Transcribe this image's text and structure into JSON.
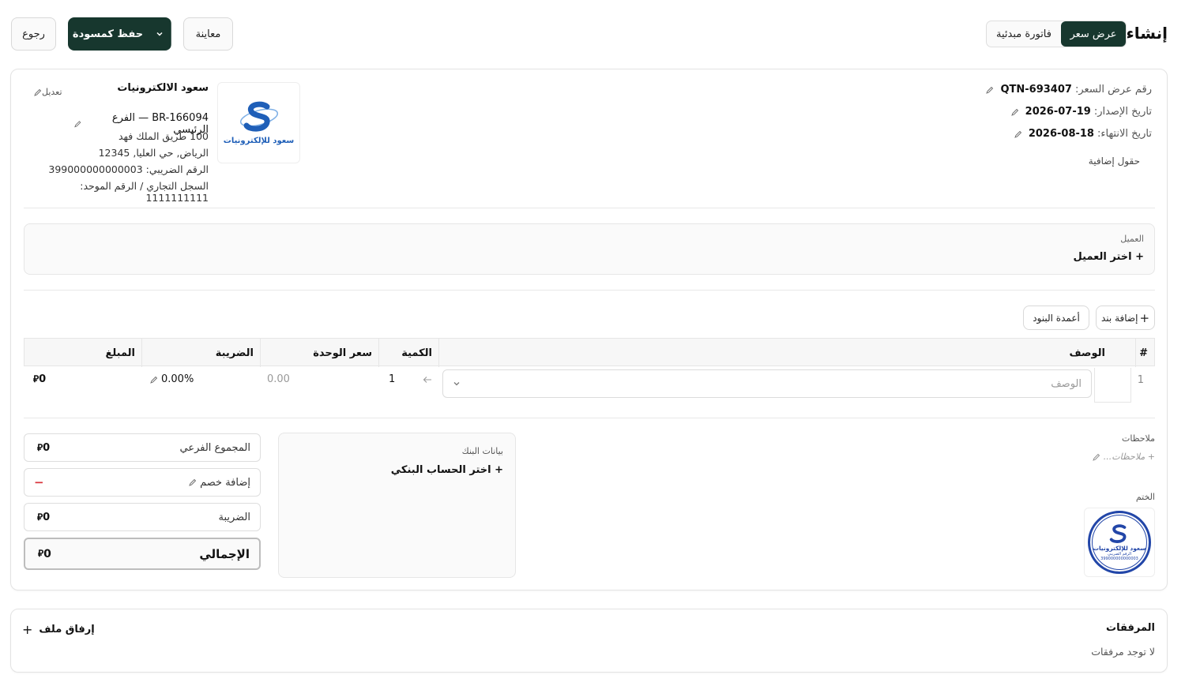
{
  "header": {
    "title": "إنشاء",
    "type_tabs": [
      {
        "label": "عرض سعر",
        "active": true
      },
      {
        "label": "فاتورة مبدئية",
        "active": false
      }
    ],
    "preview_label": "معاينة",
    "save_draft_label": "حفظ كمسودة",
    "back_label": "رجوع"
  },
  "doc_info": {
    "number_label": "رقم عرض السعر:",
    "number_value": "QTN-693407",
    "issue_label": "تاريخ الإصدار:",
    "issue_value": "2026-07-19",
    "expiry_label": "تاريخ الانتهاء:",
    "expiry_value": "2026-08-18",
    "extra_fields": "حقول إضافية"
  },
  "company": {
    "name": "سعود الالكترونيات",
    "edit_label": "تعديل",
    "branch": "BR-166094 — الفرع الرئيسي",
    "address1": "100 طريق الملك فهد",
    "address2": "الرياض, حي العليا, 12345",
    "vat": "الرقم الضريبي: 399000000000003",
    "cr": "السجل التجاري / الرقم الموحد: 1111111111",
    "logo_text": "سعود للإلكترونيات"
  },
  "customer": {
    "label": "العميل",
    "select": "+ اختر العميل"
  },
  "items": {
    "add_item": "إضافة بند",
    "columns_btn": "أعمدة البنود",
    "headers": {
      "num": "#",
      "desc": "الوصف",
      "qty": "الكمية",
      "unit": "سعر الوحدة",
      "tax": "الضريبة",
      "amount": "المبلغ"
    },
    "rows": [
      {
        "num": "1",
        "desc_placeholder": "الوصف",
        "qty": "1",
        "unit": "0.00",
        "tax": "0.00%",
        "amount": "0"
      }
    ],
    "currency": "⃁"
  },
  "bank": {
    "label": "بيانات البنك",
    "select": "+ اختر الحساب البنكي"
  },
  "notes": {
    "label": "ملاحظات",
    "placeholder": "+ ملاحظات..."
  },
  "stamp": {
    "label": "الختم",
    "text": "سعود للإلكترونيات",
    "sub": "الرقم الضريبي",
    "number": "399000000000003"
  },
  "totals": {
    "subtotal_label": "المجموع الفرعي",
    "subtotal": "0",
    "discount_label": "إضافة خصم",
    "discount_sign": "−",
    "tax_label": "الضريبة",
    "tax": "0",
    "total_label": "الإجمالي",
    "total": "0"
  },
  "attachments": {
    "title": "المرفقات",
    "empty": "لا توجد مرفقات",
    "attach_btn": "إرفاق ملف"
  },
  "colors": {
    "primary": "#17372e",
    "border": "#e3e3e3",
    "danger": "#d9363e",
    "logo_blue": "#1f5fb8"
  }
}
